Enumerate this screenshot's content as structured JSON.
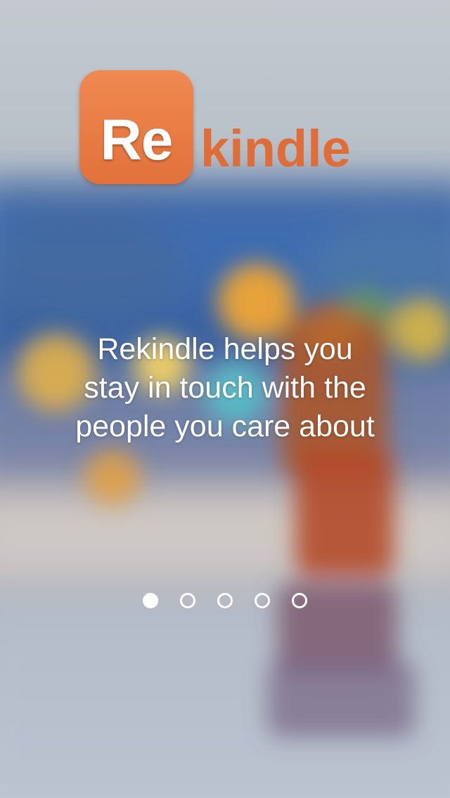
{
  "logo": {
    "box_text": "Re",
    "rest_text": "kindle"
  },
  "tagline": "Rekindle helps you stay in touch with the people you care about",
  "pagination": {
    "pages": 5,
    "active_index": 0
  },
  "colors": {
    "brand": "#e06d36",
    "logo_box": "#ea7d45",
    "text": "#ffffff"
  }
}
